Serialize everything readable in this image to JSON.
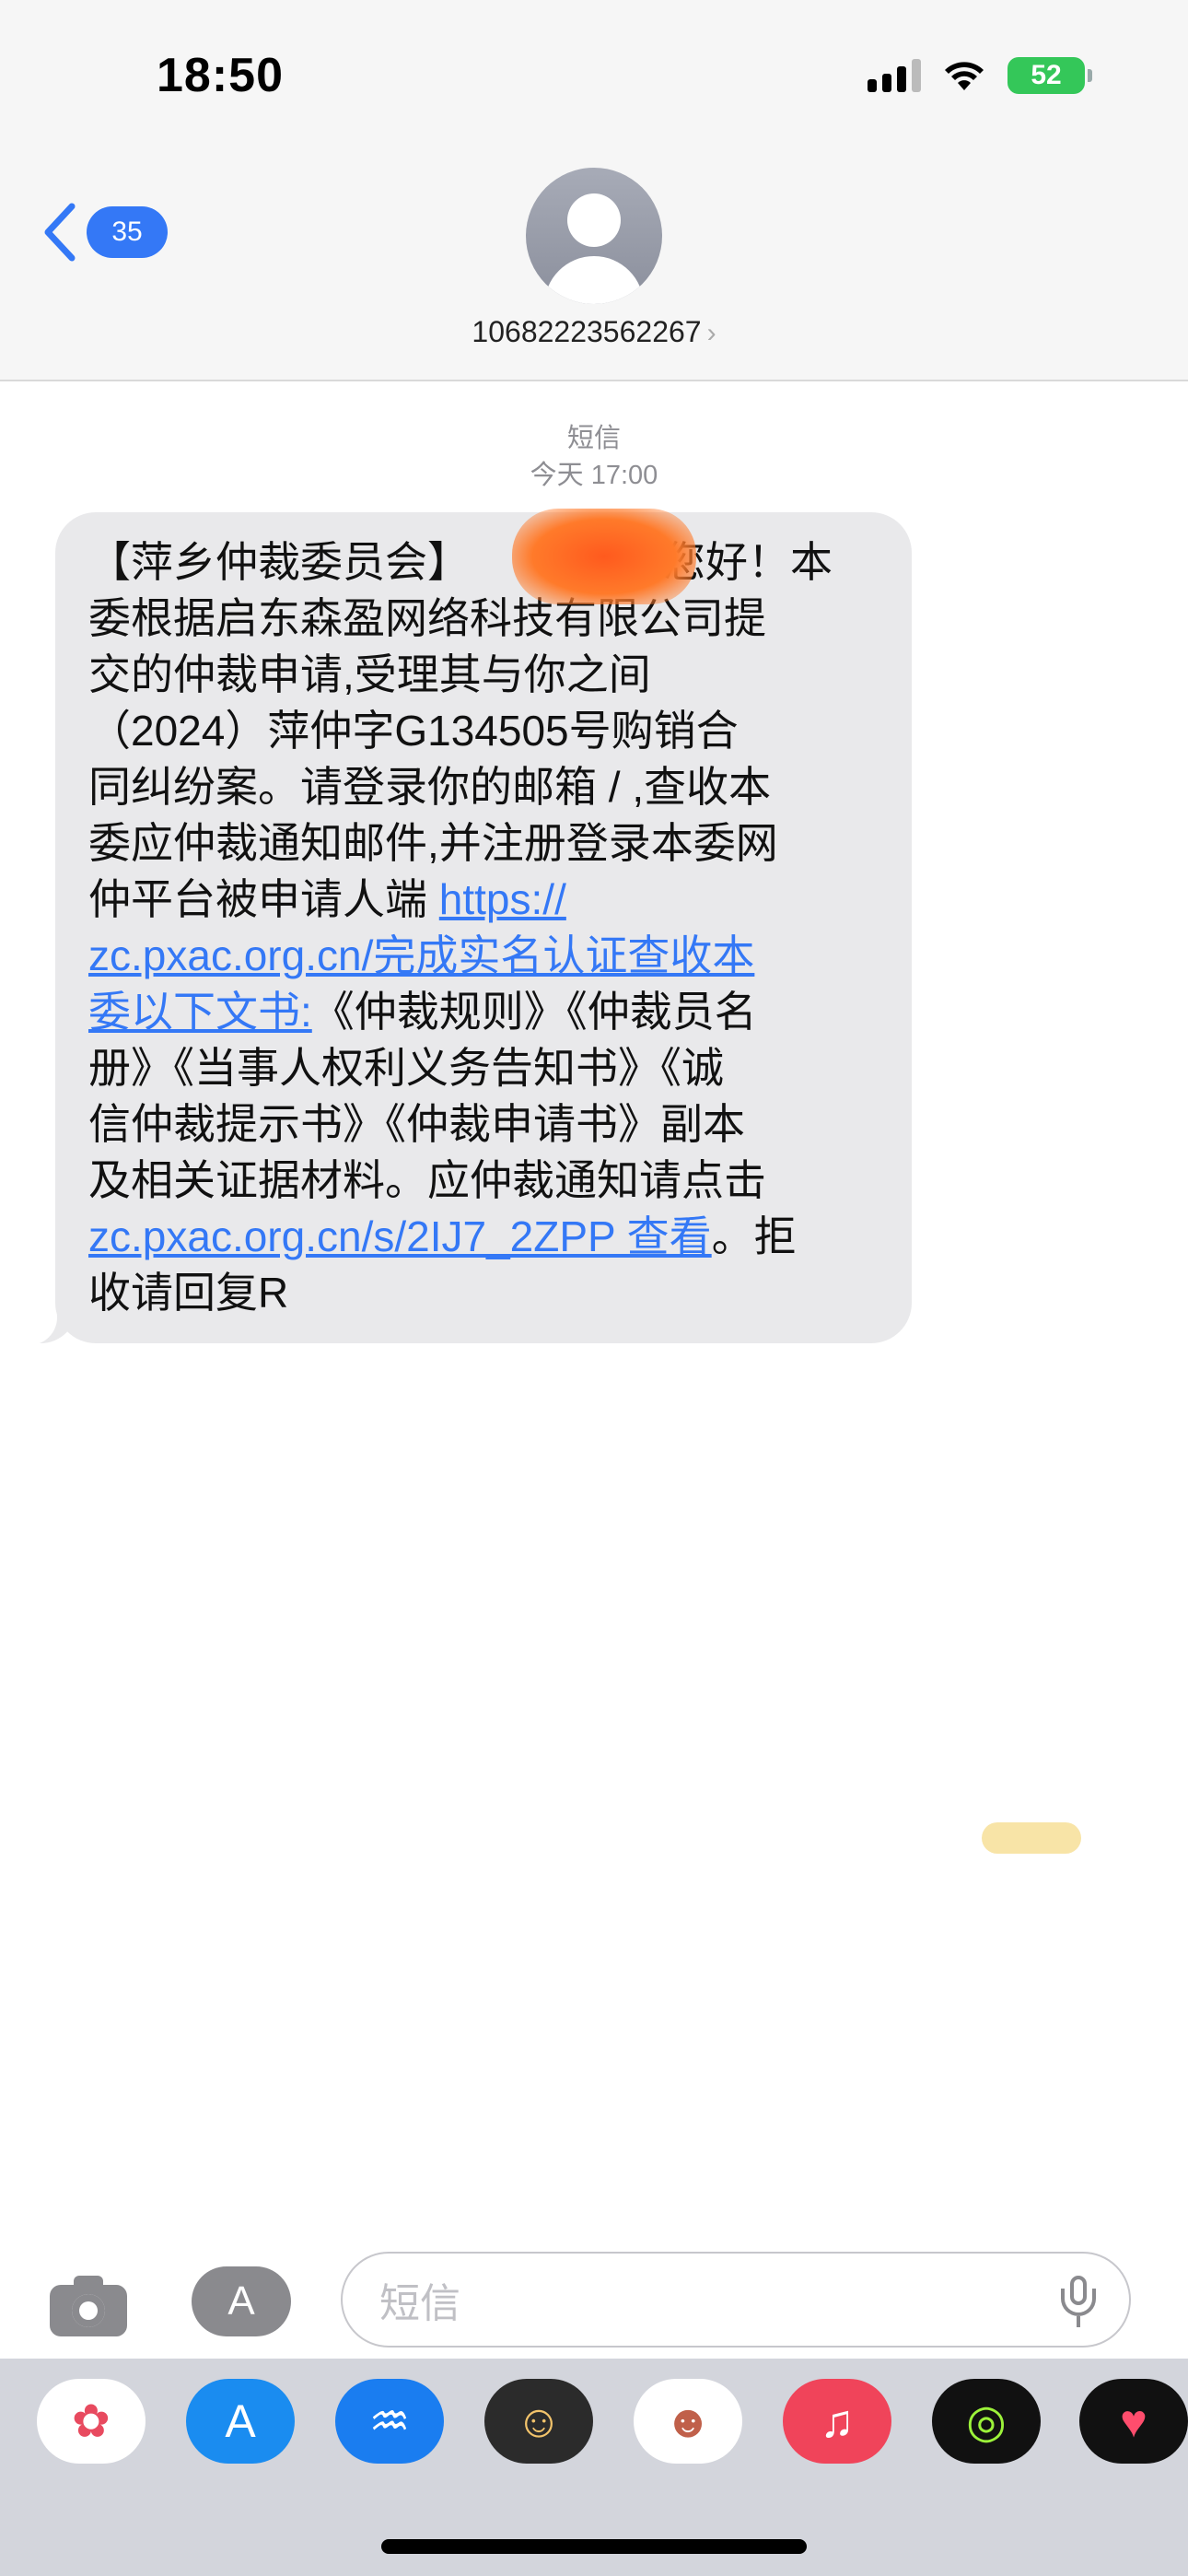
{
  "status_bar": {
    "time": "18:50",
    "battery": "52"
  },
  "header": {
    "back_count": "35",
    "contact": "10682223562267",
    "contact_chevron": "›"
  },
  "thread": {
    "service": "短信",
    "timestamp": "今天 17:00"
  },
  "message": {
    "parts": [
      {
        "text": "【萍乡仲裁委员会】",
        "link": false
      },
      {
        "text": "您好！本委根据启东森盈网络科技有限公司提交的仲裁申请,受理其与你之间（2024）萍仲字G134505号购销合同纠纷案。请登录你的邮箱 / ,查收本委应仲裁通知邮件,并注册登录本委网仲平台被申请人端 ",
        "link": false
      },
      {
        "text": "https://zc.pxac.org.cn/完成实名认证查收本委以下文书:",
        "link": true
      },
      {
        "text": "《仲裁规则》《仲裁员名册》《当事人权利义务告知书》《诚信仲裁提示书》《仲裁申请书》副本及相关证据材料。应仲裁通知请点击",
        "link": false
      },
      {
        "text": "zc.pxac.org.cn/s/2IJ7_2ZPP查看",
        "link": true
      },
      {
        "text": "。拒收请回复R",
        "link": false
      }
    ],
    "lines": [
      [
        {
          "t": "【萍乡仲裁委员会】",
          "link": false
        },
        {
          "t": "",
          "link": false
        },
        {
          "t": "您好！本",
          "link": false
        }
      ],
      [
        {
          "t": "委根据启东森盈网络科技有限公司提",
          "link": false
        }
      ],
      [
        {
          "t": "交的仲裁申请,受理其与你之间",
          "link": false
        }
      ],
      [
        {
          "t": "（2024）萍仲字G134505号购销合",
          "link": false
        }
      ],
      [
        {
          "t": "同纠纷案。请登录你的邮箱 / ,查收本",
          "link": false
        }
      ],
      [
        {
          "t": "委应仲裁通知邮件,并注册登录本委网",
          "link": false
        }
      ],
      [
        {
          "t": "仲平台被申请人端 ",
          "link": false
        },
        {
          "t": "https://",
          "link": true
        }
      ],
      [
        {
          "t": "zc.pxac.org.cn/完成实名认证查收本",
          "link": true
        }
      ],
      [
        {
          "t": "委以下文书:",
          "link": true
        },
        {
          "t": "《仲裁规则》《仲裁员名",
          "link": false
        }
      ],
      [
        {
          "t": "册》《当事人权利义务告知书》《诚",
          "link": false
        }
      ],
      [
        {
          "t": "信仲裁提示书》《仲裁申请书》副本",
          "link": false
        }
      ],
      [
        {
          "t": "及相关证据材料。应仲裁通知请点击",
          "link": false
        }
      ],
      [
        {
          "t": "zc.pxac.org.cn/s/2IJ7_2ZPP 查看",
          "link": true
        },
        {
          "t": "。拒",
          "link": false
        }
      ],
      [
        {
          "t": "收请回复R",
          "link": false
        }
      ]
    ]
  },
  "composer": {
    "placeholder": "短信",
    "apps_glyph": "A"
  },
  "app_tray": [
    {
      "name": "photos",
      "glyph": "✿",
      "bg": "#ffffff",
      "fg": "#e84a5f"
    },
    {
      "name": "app-store",
      "glyph": "A",
      "bg": "#1a8cf0",
      "fg": "#ffffff"
    },
    {
      "name": "audio",
      "glyph": "♒",
      "bg": "#1a7df0",
      "fg": "#ffffff"
    },
    {
      "name": "memoji",
      "glyph": "☺",
      "bg": "#2b2b2b",
      "fg": "#f2c36b"
    },
    {
      "name": "memoji-stickers",
      "glyph": "☻",
      "bg": "#ffffff",
      "fg": "#c0604a"
    },
    {
      "name": "music",
      "glyph": "♫",
      "bg": "#f0445a",
      "fg": "#ffffff"
    },
    {
      "name": "fitness",
      "glyph": "◎",
      "bg": "#111111",
      "fg": "#9cf23a"
    },
    {
      "name": "digital-touch",
      "glyph": "♥",
      "bg": "#111111",
      "fg": "#ff4d6d"
    }
  ],
  "colors": {
    "accent": "#3478f6",
    "bubble": "#e9e9eb",
    "tray": "#d3d5dc"
  }
}
